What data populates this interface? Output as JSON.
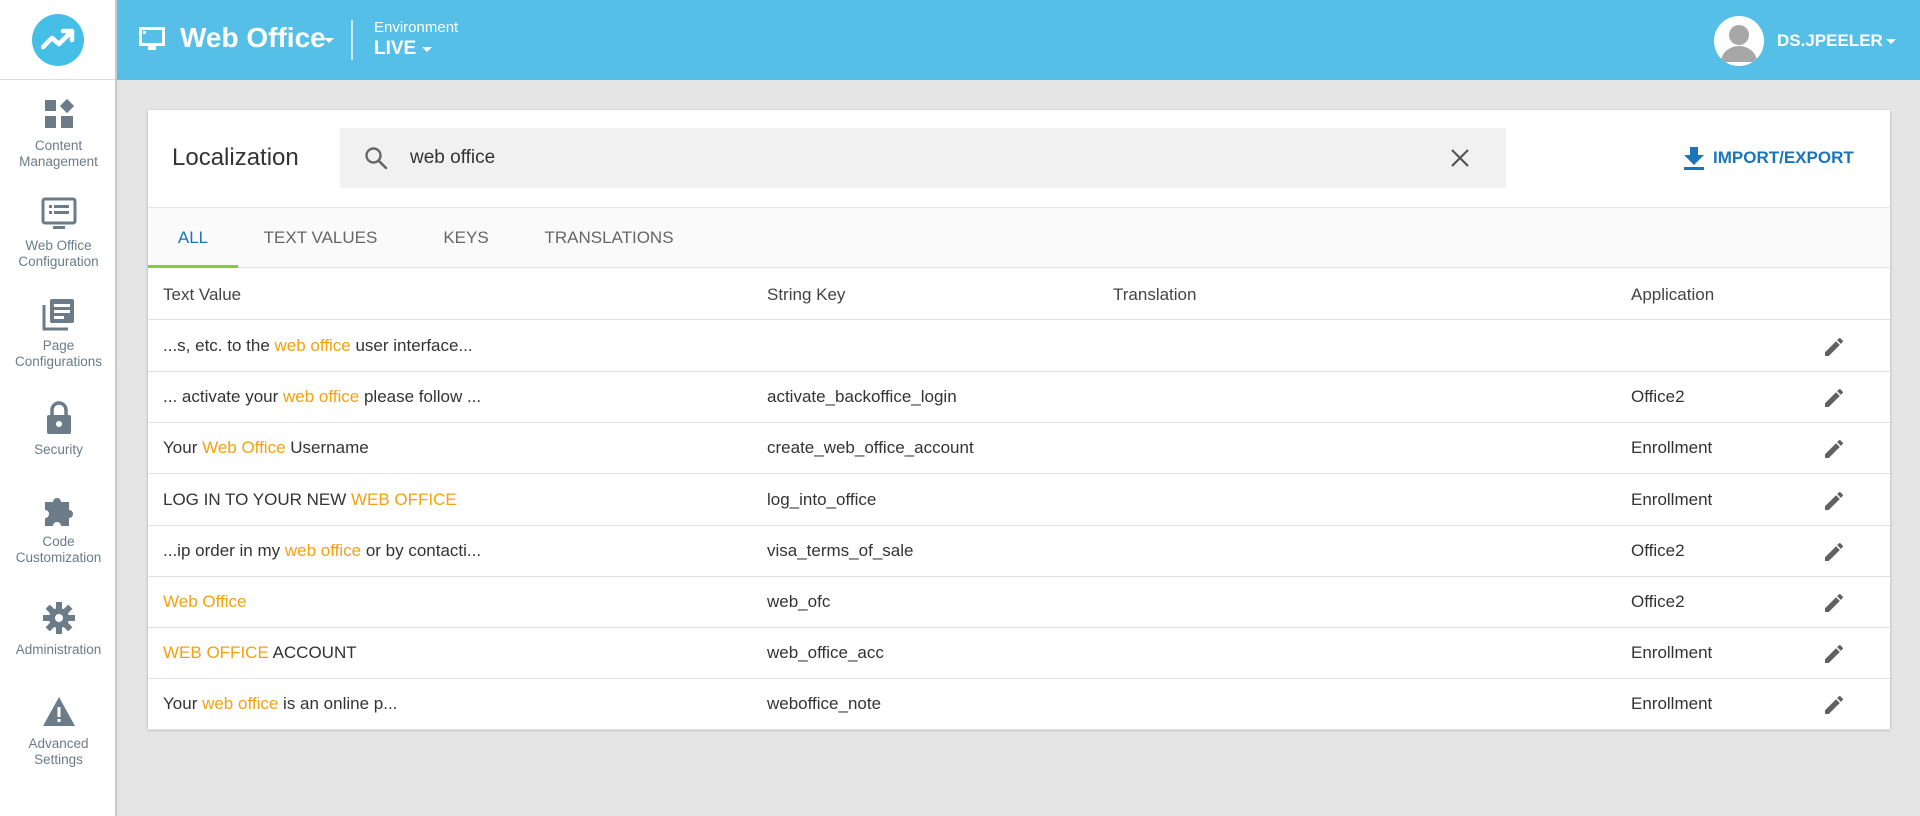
{
  "colors": {
    "accent": "#56bfe8",
    "highlight": "#f5a10f",
    "link": "#1a75bb",
    "tab_indicator": "#8dc63f"
  },
  "sidebar": {
    "logo": "chart-trend-logo",
    "items": [
      {
        "label": "Content\nManagement",
        "icon": "dashboard-icon"
      },
      {
        "label": "Web Office\nConfiguration",
        "icon": "monitor-list-icon"
      },
      {
        "label": "Page\nConfigurations",
        "icon": "library-books-icon"
      },
      {
        "label": "Security",
        "icon": "lock-icon"
      },
      {
        "label": "Code\nCustomization",
        "icon": "puzzle-icon"
      },
      {
        "label": "Administration",
        "icon": "gear-icon"
      },
      {
        "label": "Advanced\nSettings",
        "icon": "warning-icon"
      }
    ]
  },
  "header": {
    "app_title": "Web Office",
    "env_label": "Environment",
    "env_value": "LIVE",
    "username": "DS.JPEELER"
  },
  "card": {
    "title": "Localization",
    "search": {
      "value": "web office",
      "placeholder": ""
    },
    "import_label": "IMPORT/EXPORT"
  },
  "tabs": [
    "ALL",
    "TEXT VALUES",
    "KEYS",
    "TRANSLATIONS"
  ],
  "table": {
    "headers": [
      "Text Value",
      "String Key",
      "Translation",
      "Application"
    ],
    "rows": [
      {
        "pre": "...s, etc. to the ",
        "hl": "web office",
        "post": " user interface...",
        "key": "",
        "translation": "",
        "app": ""
      },
      {
        "pre": "... activate your ",
        "hl": "web office",
        "post": " please follow ...",
        "key": "activate_backoffice_login",
        "translation": "",
        "app": "Office2"
      },
      {
        "pre": "Your ",
        "hl": "Web Office",
        "post": " Username",
        "key": "create_web_office_account",
        "translation": "",
        "app": "Enrollment"
      },
      {
        "pre": "LOG IN TO YOUR NEW ",
        "hl": "WEB OFFICE",
        "post": "",
        "key": "log_into_office",
        "translation": "",
        "app": "Enrollment"
      },
      {
        "pre": "...ip order in my ",
        "hl": "web office",
        "post": " or by contacti...",
        "key": "visa_terms_of_sale",
        "translation": "",
        "app": "Office2"
      },
      {
        "pre": "",
        "hl": "Web Office",
        "post": "",
        "key": "web_ofc",
        "translation": "",
        "app": "Office2"
      },
      {
        "pre": "",
        "hl": "WEB OFFICE",
        "post": " ACCOUNT",
        "key": "web_office_acc",
        "translation": "",
        "app": "Enrollment"
      },
      {
        "pre": "Your ",
        "hl": "web office",
        "post": " is an online p...",
        "key": "weboffice_note",
        "translation": "",
        "app": "Enrollment"
      }
    ]
  }
}
